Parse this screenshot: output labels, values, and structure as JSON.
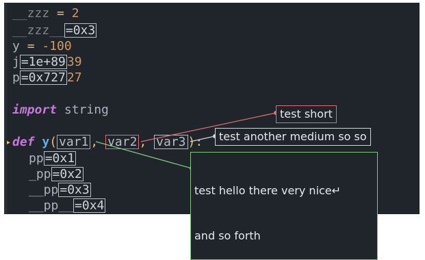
{
  "lines": {
    "l1": {
      "name": "__zzz",
      "op": "=",
      "value": "2"
    },
    "l2": {
      "name": "__zzz__",
      "hint": "=0x3"
    },
    "l3": {
      "name": "y",
      "op": "=",
      "value": "-100"
    },
    "l4": {
      "name": "j",
      "hint": "=1e+89",
      "tail": "39"
    },
    "l5": {
      "name": "p",
      "hint": "=0x727",
      "tail": "27"
    },
    "l6": {
      "kw": "import",
      "mod": "string"
    },
    "l7": {
      "kw": "def",
      "fn": "y",
      "open": "(",
      "a1": "var1",
      "c1": ",",
      "a2": "var2",
      "c2": ",",
      "a3": "var3",
      "close": "):"
    },
    "l8": {
      "name": "pp",
      "hint": "=0x1"
    },
    "l9": {
      "name": "_pp",
      "hint": "=0x2"
    },
    "l10": {
      "name": "__pp",
      "hint": "=0x3"
    },
    "l11": {
      "name": "__pp__",
      "hint": "=0x4"
    }
  },
  "notes": {
    "short": "test short",
    "medium": "test another medium so so",
    "long_1": "test hello there very nice↵",
    "long_2": "and so forth"
  },
  "colors": {
    "background": "#20242b",
    "red": "#e06c75",
    "green": "#7ec87e",
    "white": "#d0d4da"
  }
}
